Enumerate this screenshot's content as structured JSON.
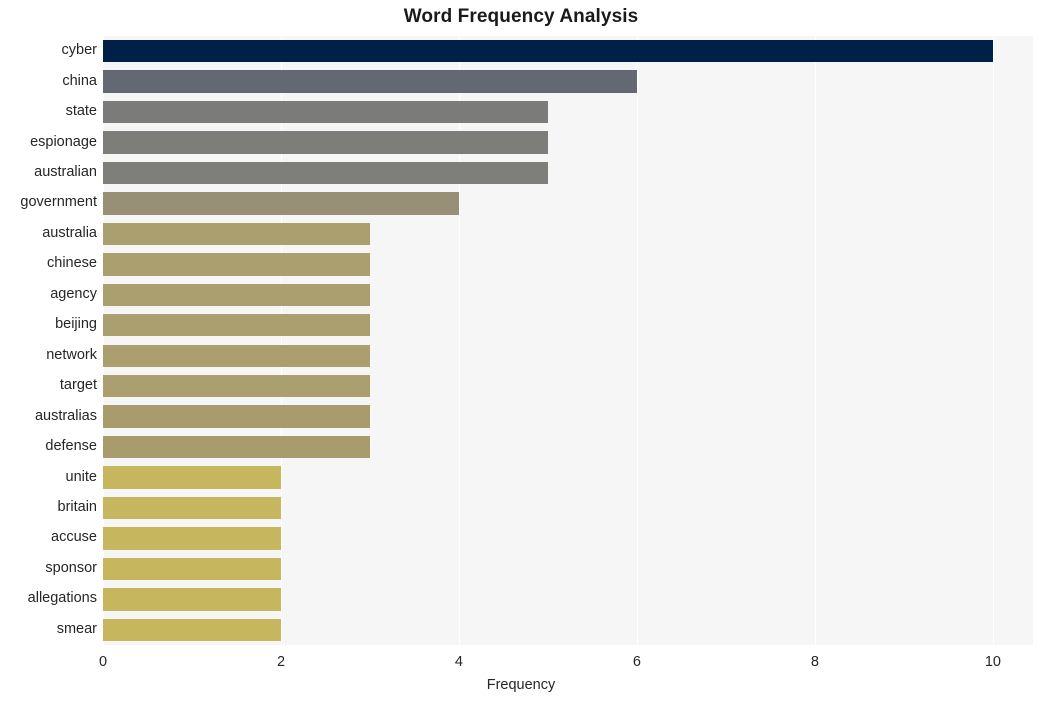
{
  "chart_data": {
    "type": "bar",
    "orientation": "horizontal",
    "title": "Word Frequency Analysis",
    "xlabel": "Frequency",
    "ylabel": "",
    "xlim": [
      0,
      10.45
    ],
    "ylim": [
      0,
      20
    ],
    "grid": true,
    "legend": false,
    "xticks": [
      0,
      2,
      4,
      6,
      8,
      10
    ],
    "xtick_labels": [
      "0",
      "2",
      "4",
      "6",
      "8",
      "10"
    ],
    "categories": [
      "cyber",
      "china",
      "state",
      "espionage",
      "australian",
      "government",
      "australia",
      "chinese",
      "agency",
      "beijing",
      "network",
      "target",
      "australias",
      "defense",
      "unite",
      "britain",
      "accuse",
      "sponsor",
      "allegations",
      "smear"
    ],
    "values": [
      10,
      6,
      5,
      5,
      5,
      4,
      3,
      3,
      3,
      3,
      3,
      3,
      3,
      3,
      2,
      2,
      2,
      2,
      2,
      2
    ],
    "bar_colors": [
      "#002147",
      "#636873",
      "#7b7b79",
      "#7d7d7a",
      "#7e7e7a",
      "#979077",
      "#ab9f6f",
      "#ab9f6f",
      "#ab9f6f",
      "#ab9f6f",
      "#ab9f6f",
      "#ab9f6f",
      "#a89c6d",
      "#a89c6d",
      "#c6b65e",
      "#c6b65e",
      "#c6b65e",
      "#c6b65e",
      "#c6b65e",
      "#c6b65e"
    ],
    "plot_background": "#f6f6f6",
    "gridline_color": "#ffffff",
    "figure_background": "#ffffff",
    "text_color": "#262626"
  }
}
